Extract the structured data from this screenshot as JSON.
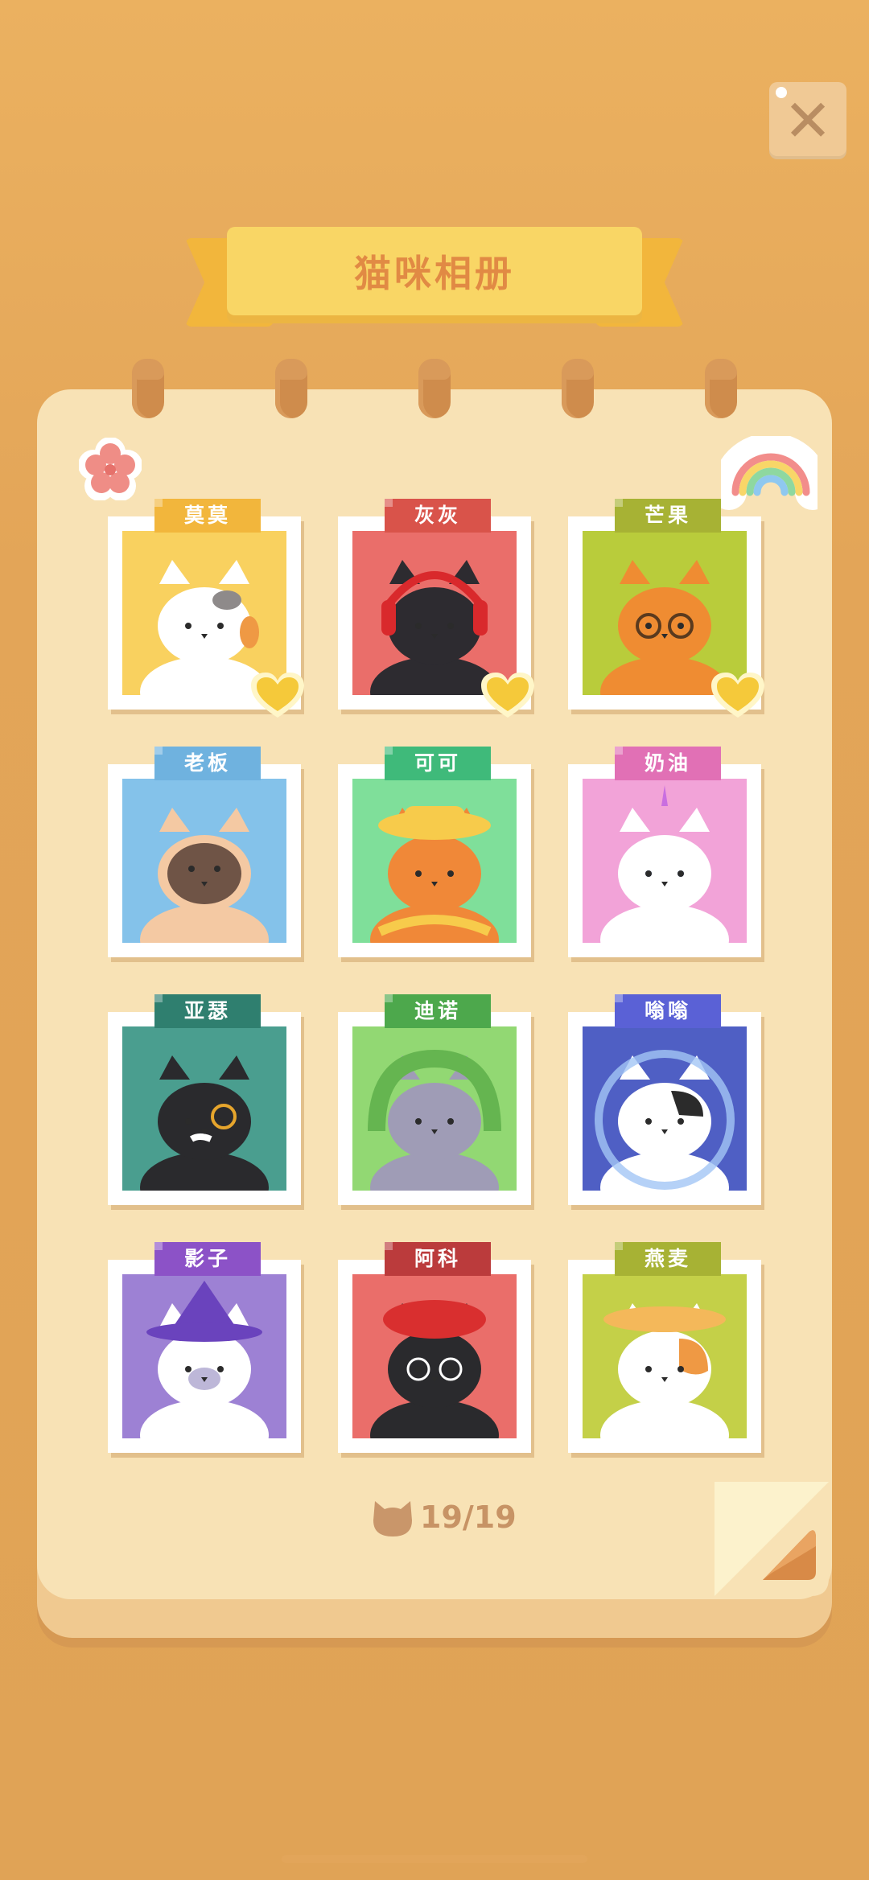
{
  "header": {
    "title": "猫咪相册",
    "close_label": "✕"
  },
  "album": {
    "count": "19/19",
    "cats": [
      {
        "name": "莫莫",
        "tag_color": "#f2b63c",
        "bg": "#f9d15f",
        "fur": "#ffffff",
        "accent": "#ef9944",
        "favorite": true
      },
      {
        "name": "灰灰",
        "tag_color": "#d9534a",
        "bg": "#ea6e6a",
        "fur": "#2d2b30",
        "accent": "#d9292c",
        "favorite": true
      },
      {
        "name": "芒果",
        "tag_color": "#a7b234",
        "bg": "#b9cc3b",
        "fur": "#ef8c32",
        "accent": "#5a3a1e",
        "favorite": true
      },
      {
        "name": "老板",
        "tag_color": "#6fb2df",
        "bg": "#84c2ea",
        "fur": "#f4c9a3",
        "accent": "#6f5446",
        "favorite": false
      },
      {
        "name": "可可",
        "tag_color": "#3fba7a",
        "bg": "#7fdf9a",
        "fur": "#f08838",
        "accent": "#f7cb4b",
        "favorite": false
      },
      {
        "name": "奶油",
        "tag_color": "#e170b5",
        "bg": "#f2a3d8",
        "fur": "#ffffff",
        "accent": "#c96fe0",
        "favorite": false
      },
      {
        "name": "亚瑟",
        "tag_color": "#2f7f6f",
        "bg": "#4a9e8f",
        "fur": "#2a2a2d",
        "accent": "#e6a52c",
        "favorite": false
      },
      {
        "name": "迪诺",
        "tag_color": "#4da84c",
        "bg": "#92d873",
        "fur": "#9f9cb6",
        "accent": "#65b550",
        "favorite": false
      },
      {
        "name": "嗡嗡",
        "tag_color": "#5a61d6",
        "bg": "#4f5fc4",
        "fur": "#ffffff",
        "accent": "#a2c5f5",
        "favorite": false
      },
      {
        "name": "影子",
        "tag_color": "#8c52c7",
        "bg": "#9d81d4",
        "fur": "#ffffff",
        "accent": "#6a43bd",
        "favorite": false
      },
      {
        "name": "阿科",
        "tag_color": "#bb3b3c",
        "bg": "#ea6e6a",
        "fur": "#2a2a2d",
        "accent": "#d92f2f",
        "favorite": false
      },
      {
        "name": "燕麦",
        "tag_color": "#a7b234",
        "bg": "#c4d048",
        "fur": "#ffffff",
        "accent": "#ef9944",
        "favorite": false
      }
    ]
  },
  "icons": {
    "close": "close-icon",
    "heart": "heart-icon",
    "cat_head": "cat-head-icon",
    "flower": "flower-sticker",
    "rainbow": "rainbow-sticker",
    "page_corner": "page-corner-icon"
  }
}
